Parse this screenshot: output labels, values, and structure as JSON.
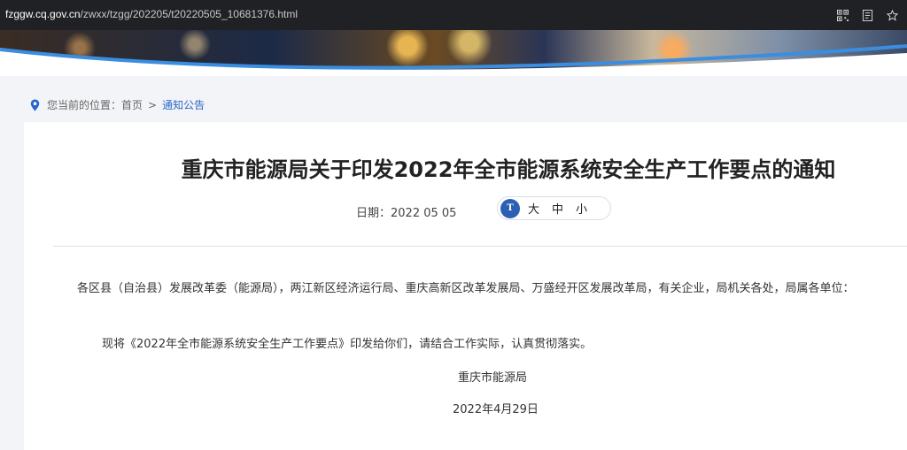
{
  "browser": {
    "url_domain": "fzggw.cq.gov.cn",
    "url_path": "/zwxx/tzgg/202205/t20220505_10681376.html"
  },
  "icons": {
    "qr": "qr-code-icon",
    "reader": "reader-mode-icon",
    "star": "bookmark-star-icon",
    "location": "location-pin-icon",
    "fontsize": "font-size-icon"
  },
  "breadcrumb": {
    "label": "您当前的位置：",
    "home": "首页",
    "separator": ">",
    "current": "通知公告"
  },
  "article": {
    "title": "重庆市能源局关于印发2022年全市能源系统安全生产工作要点的通知",
    "date_label": "日期：",
    "date_value": "2022 05 05",
    "fontsize_large": "大",
    "fontsize_medium": "中",
    "fontsize_small": "小",
    "fontsize_icon_text": "T",
    "recipients": "各区县（自治县）发展改革委（能源局），两江新区经济运行局、重庆高新区改革发展局、万盛经开区发展改革局，有关企业，局机关各处，局属各单位：",
    "body": "现将《2022年全市能源系统安全生产工作要点》印发给你们，请结合工作实际，认真贯彻落实。",
    "signature": "重庆市能源局",
    "sign_date": "2022年4月29日"
  },
  "colors": {
    "accent": "#2a66c9",
    "page_bg": "#f2f4f7",
    "address_bar": "#202124"
  }
}
